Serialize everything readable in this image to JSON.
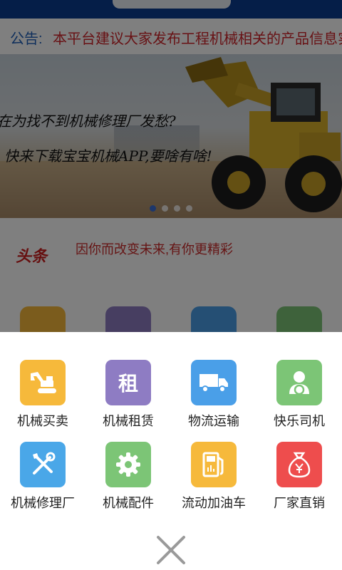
{
  "notice": {
    "label": "公告:",
    "text": "本平台建议大家发布工程机械相关的产品信息实"
  },
  "banner": {
    "line1": "在为找不到机械修理厂发愁?",
    "line2": "快来下载宝宝机械APP,要啥有啥!",
    "slide_count": 4,
    "active_slide": 1
  },
  "headline": {
    "tag": "头条",
    "text": "因你而改变未来,有你更精彩"
  },
  "menu": {
    "items": [
      {
        "label": "机械买卖",
        "icon": "excavator-icon",
        "color": "#f6b93b"
      },
      {
        "label": "机械租赁",
        "icon": "rent-icon",
        "tile_text": "租",
        "color": "#8e7cc3"
      },
      {
        "label": "物流运输",
        "icon": "truck-icon",
        "color": "#4a9fe8"
      },
      {
        "label": "快乐司机",
        "icon": "driver-icon",
        "color": "#7cc576"
      },
      {
        "label": "机械修理厂",
        "icon": "repair-tools-icon",
        "color": "#4aa7e8"
      },
      {
        "label": "机械配件",
        "icon": "gear-icon",
        "color": "#7cc576"
      },
      {
        "label": "流动加油车",
        "icon": "fuel-pump-icon",
        "color": "#f6b93b"
      },
      {
        "label": "厂家直销",
        "icon": "money-bag-icon",
        "color": "#ee4d4d"
      }
    ]
  },
  "close": {
    "icon": "close-icon"
  }
}
